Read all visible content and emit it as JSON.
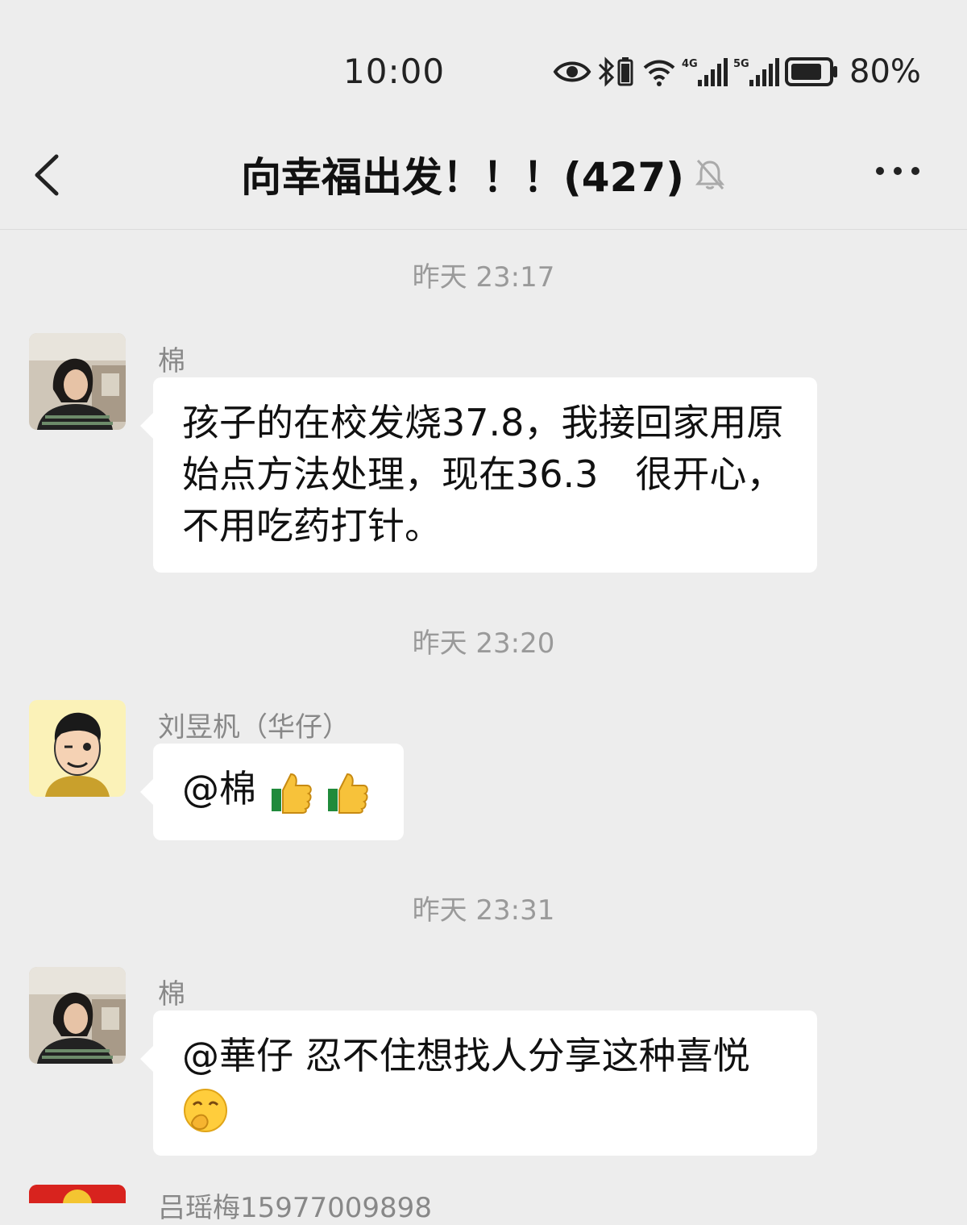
{
  "status_bar": {
    "time": "10:00",
    "net1": "4G",
    "net2": "5G",
    "battery": "80%"
  },
  "header": {
    "title": "向幸福出发！！！(427)"
  },
  "messages": [
    {
      "timestamp": "昨天 23:17",
      "sender": "棉",
      "text": "孩子的在校发烧37.8，我接回家用原始点方法处理，现在36.3　很开心，不用吃药打针。"
    },
    {
      "timestamp": "昨天 23:20",
      "sender": "刘昱杋（华仔）",
      "text": "@棉 ",
      "emojis": [
        "thumbs-up-icon",
        "thumbs-up-icon"
      ]
    },
    {
      "timestamp": "昨天 23:31",
      "sender": "棉",
      "text": "@華仔  忍不住想找人分享这种喜悦",
      "emojis": [
        "shy-face-icon"
      ]
    },
    {
      "sender": "吕瑶梅15977009898"
    }
  ]
}
